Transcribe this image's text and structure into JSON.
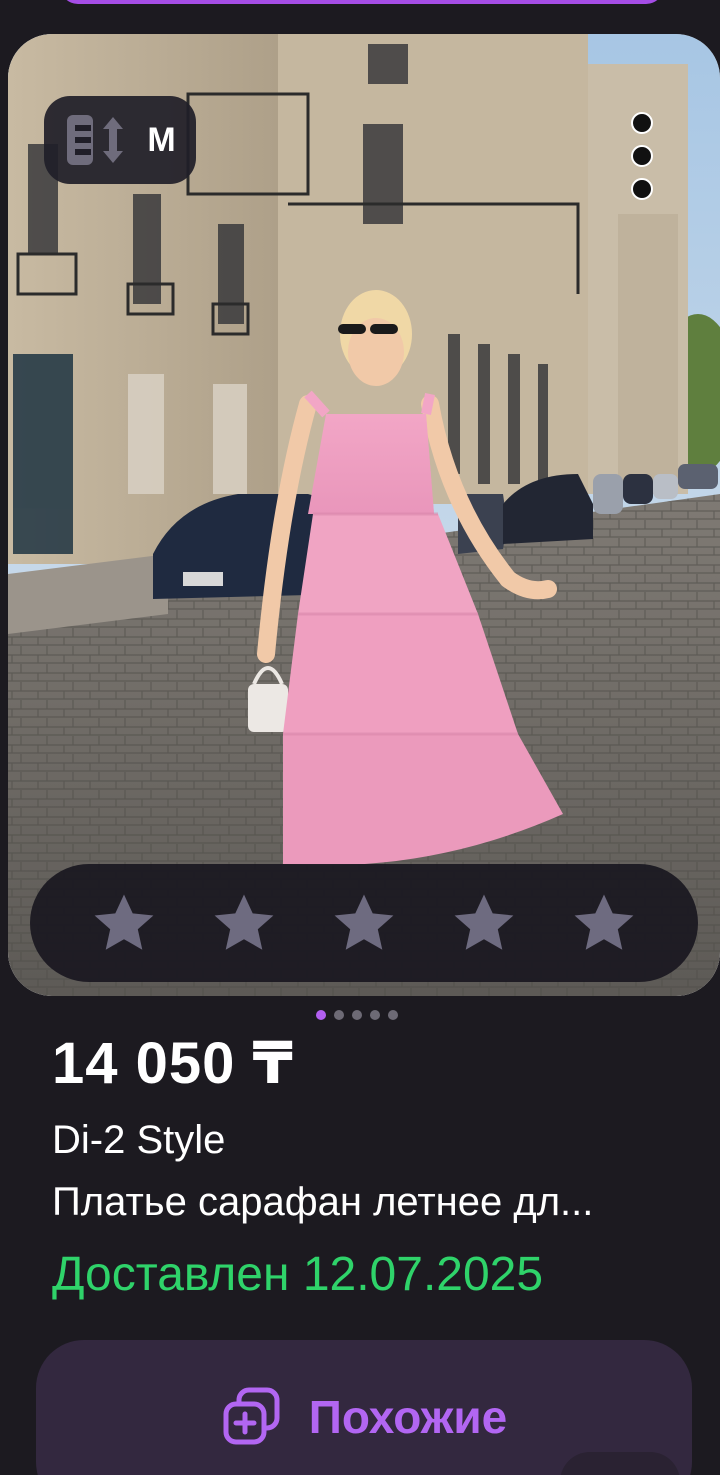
{
  "size_badge": {
    "icon": "size-fit-icon",
    "label": "M"
  },
  "menu": {
    "icon": "more-vertical-icon"
  },
  "rating": {
    "stars": 5,
    "selected": 0,
    "icon": "star-icon",
    "star_color": "#6e6b80"
  },
  "carousel": {
    "count": 5,
    "active_index": 0,
    "active_color": "#b25ff0"
  },
  "product": {
    "price": "14 050 ₸",
    "brand": "Di-2 Style",
    "name": "Платье сарафан летнее дл...",
    "delivery_status": "Доставлен 12.07.2025",
    "delivery_color": "#2fd36a"
  },
  "actions": {
    "similar_label": "Похожие",
    "similar_icon": "similar-squares-icon",
    "accent": "#b266f2"
  }
}
